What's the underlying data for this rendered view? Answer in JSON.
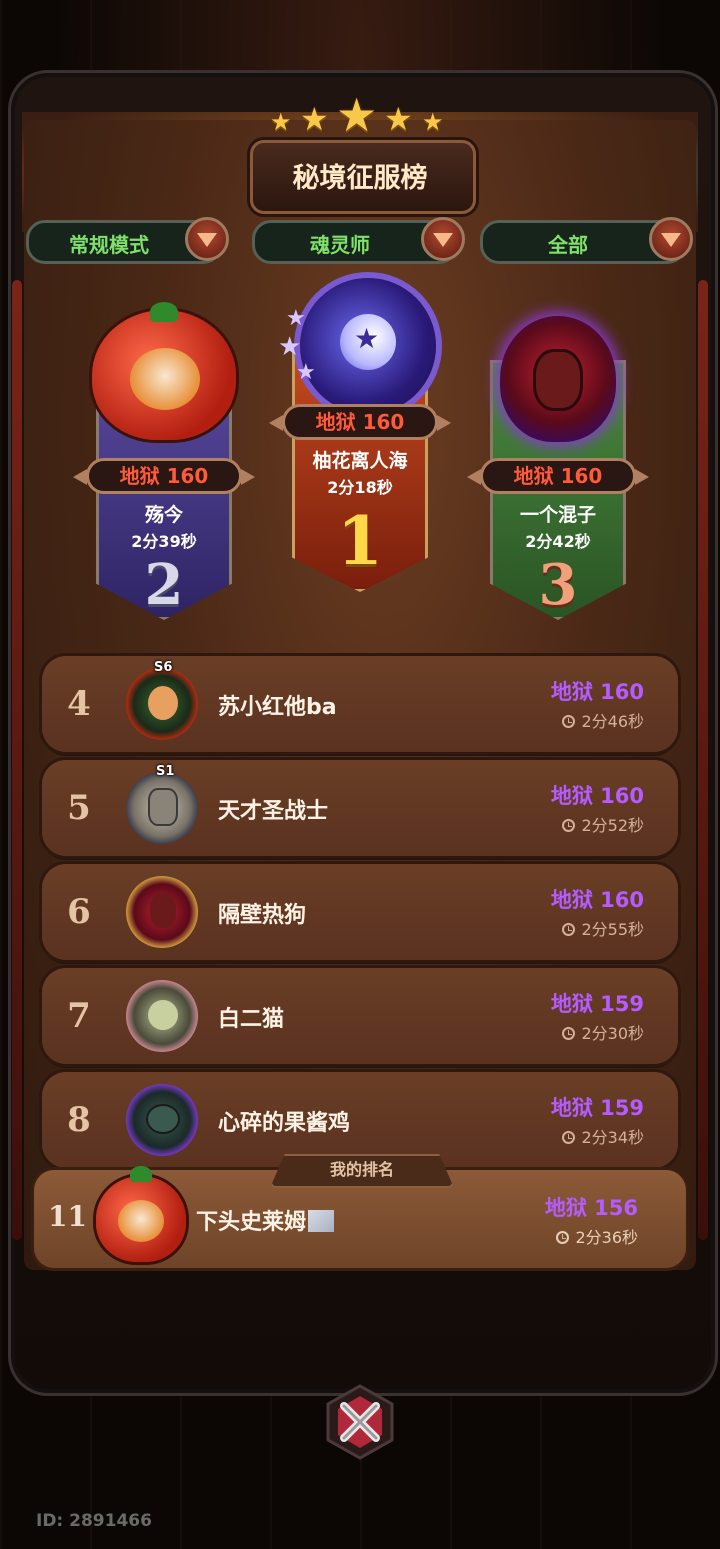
{
  "title": "秘境征服榜",
  "filters": [
    {
      "label": "常规模式"
    },
    {
      "label": "魂灵师"
    },
    {
      "label": "全部"
    }
  ],
  "podium": {
    "first": {
      "rank": "1",
      "score": "地狱 160",
      "name": "柚花离人海",
      "time": "2分18秒"
    },
    "second": {
      "rank": "2",
      "score": "地狱 160",
      "name": "殇今",
      "time": "2分39秒"
    },
    "third": {
      "rank": "3",
      "score": "地狱 160",
      "name": "一个混子",
      "time": "2分42秒"
    }
  },
  "rows": [
    {
      "rank": "4",
      "name": "苏小红他ba",
      "score": "地狱 160",
      "time": "2分46秒",
      "season": "S6"
    },
    {
      "rank": "5",
      "name": "天才圣战士",
      "score": "地狱 160",
      "time": "2分52秒",
      "season": "S1"
    },
    {
      "rank": "6",
      "name": "隔壁热狗",
      "score": "地狱 160",
      "time": "2分55秒"
    },
    {
      "rank": "7",
      "name": "白二猫",
      "score": "地狱 159",
      "time": "2分30秒"
    },
    {
      "rank": "8",
      "name": "心碎的果酱鸡",
      "score": "地狱 159",
      "time": "2分34秒"
    }
  ],
  "my_rank": {
    "label": "我的排名",
    "rank": "11",
    "name": "下头史莱姆",
    "score": "地狱 156",
    "time": "2分36秒"
  },
  "footer": {
    "id_text": "ID: 2891466"
  },
  "colors": {
    "score_purple": "#b45cff",
    "hell_red": "#ff5a3a",
    "filter_green": "#7fe06a",
    "gold": "#f8c84a"
  },
  "icons": [
    "dropdown-arrow-icon",
    "clock-icon",
    "close-x-icon",
    "star-icon"
  ]
}
